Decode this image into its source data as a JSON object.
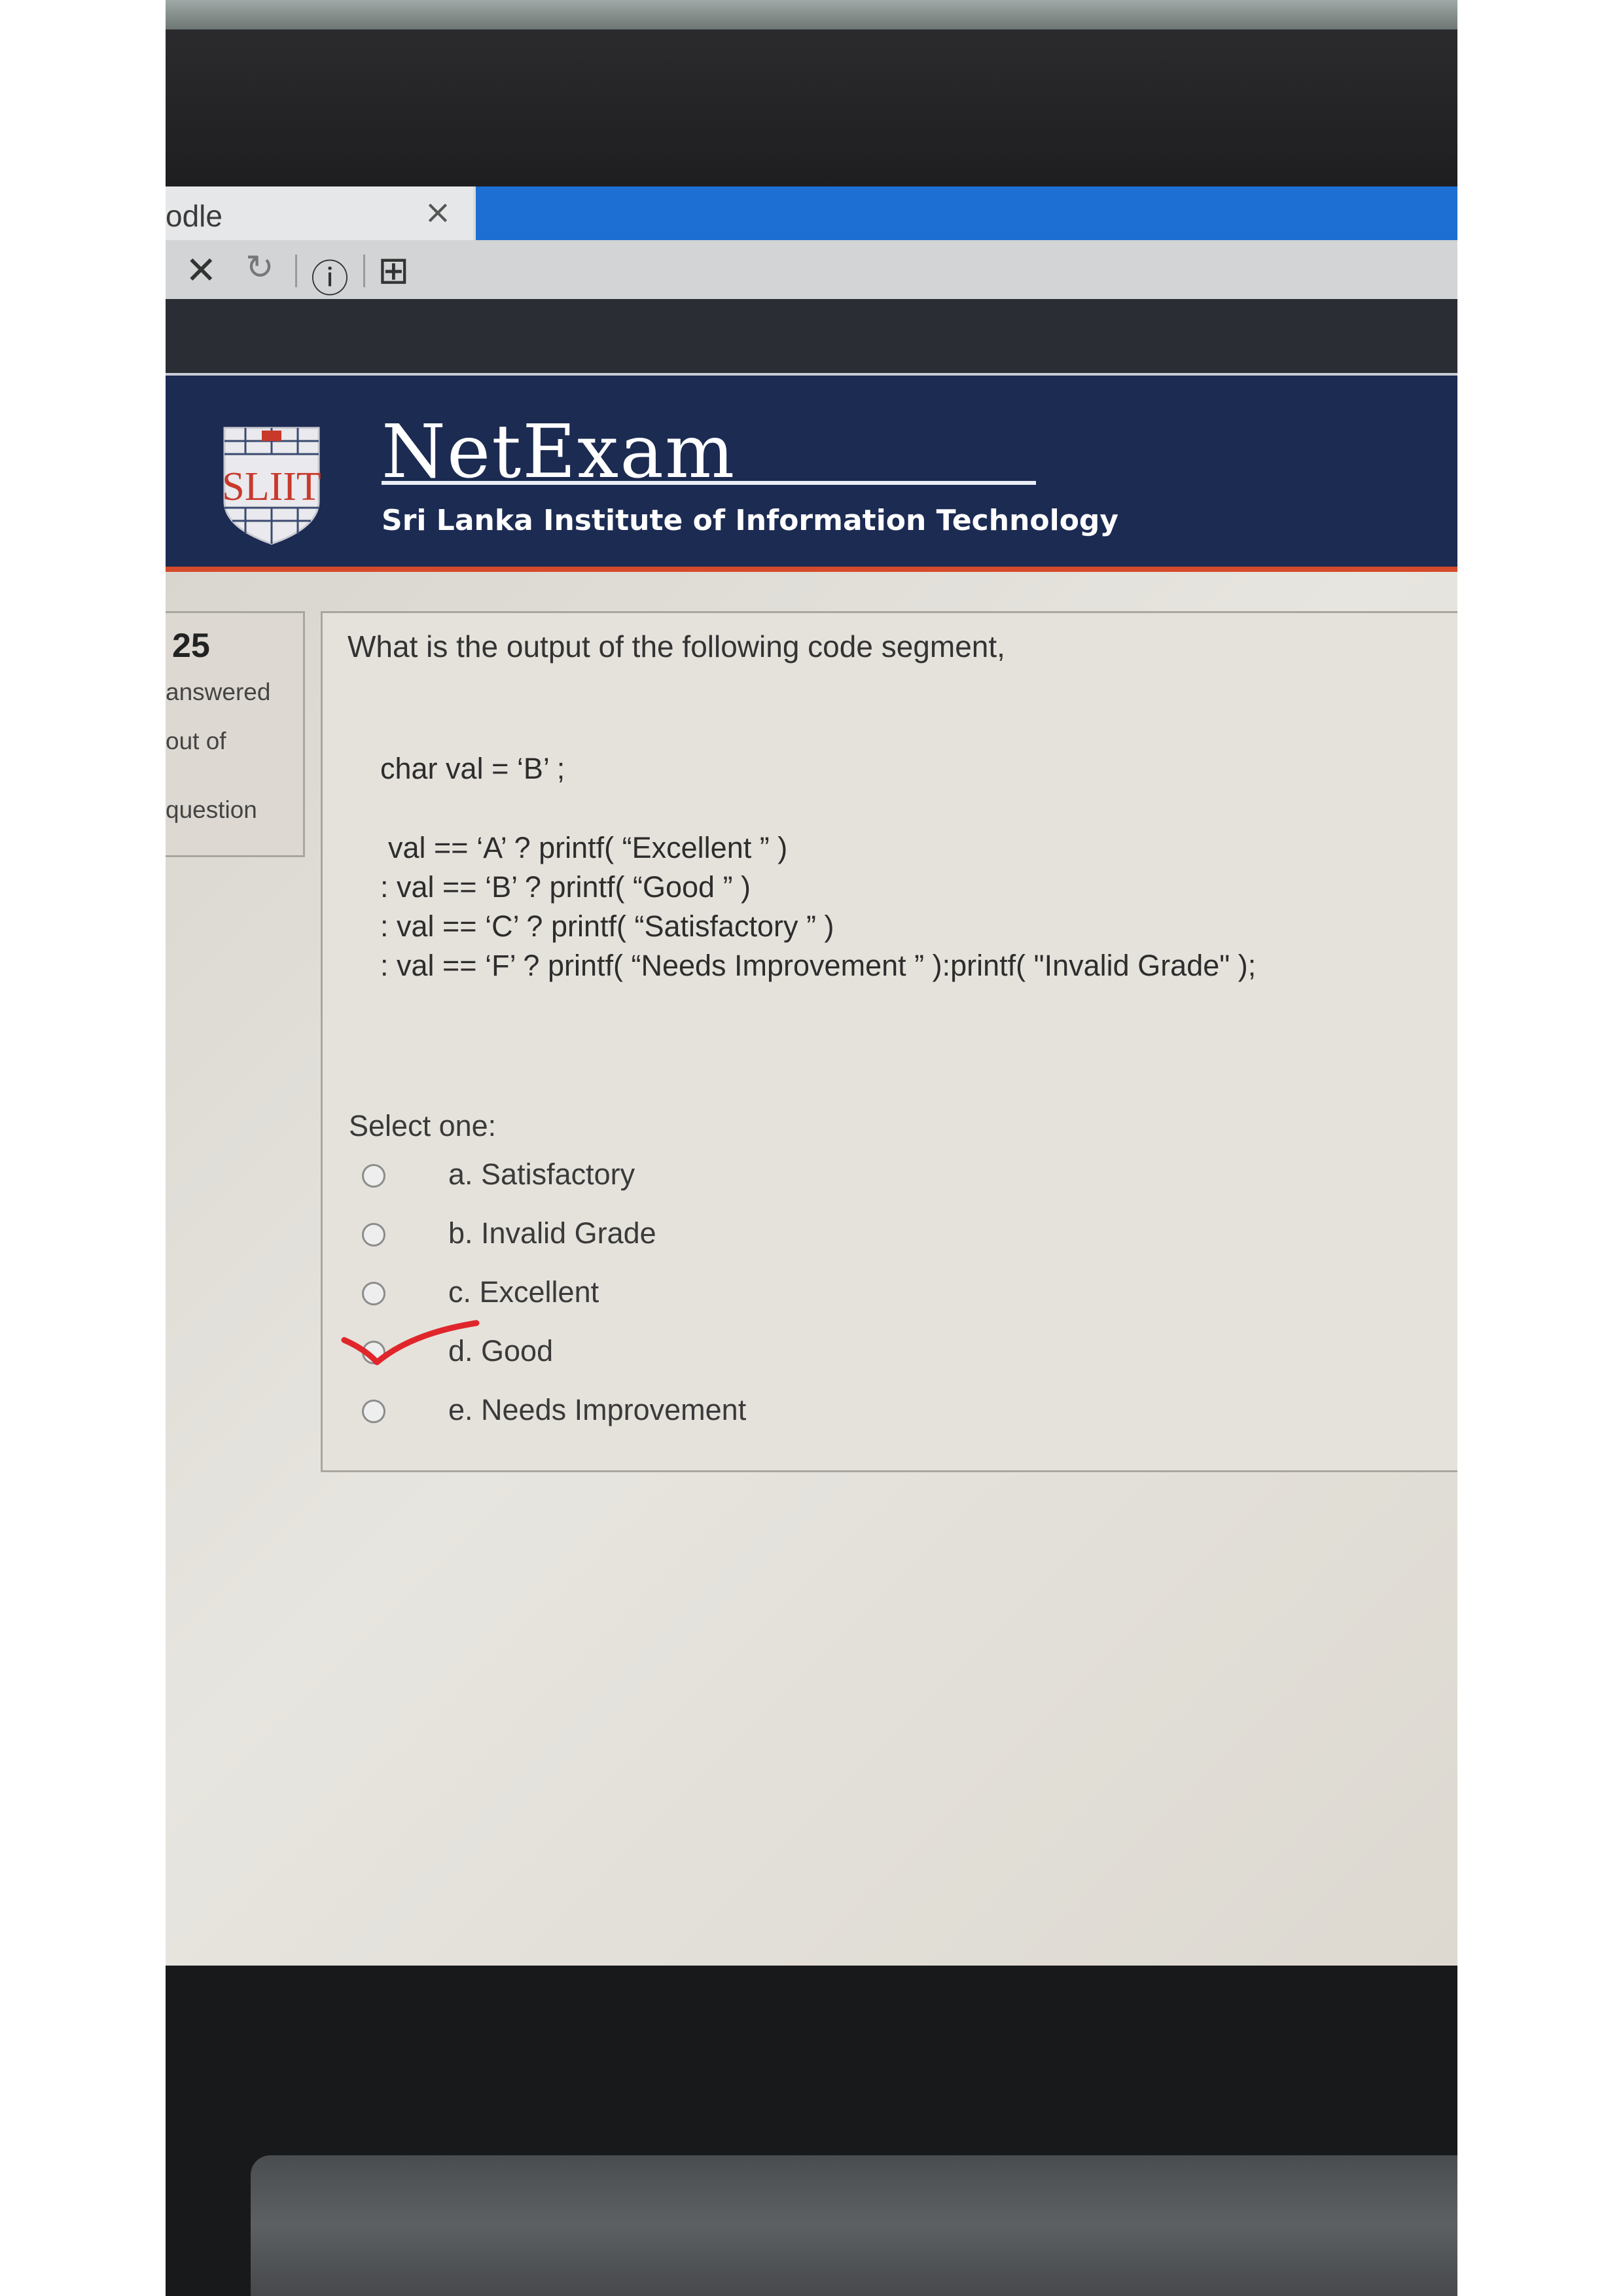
{
  "browser": {
    "tab_title": "odle",
    "tab_close_glyph": "×",
    "toolbar_icons": [
      "close-icon",
      "reload-icon",
      "info-icon",
      "add-page-icon"
    ],
    "stop_glyph": "✕",
    "reload_glyph": "↻",
    "info_glyph": "ⓘ",
    "page_glyph": "⊞",
    "accent_color": "#1d6fd3"
  },
  "header": {
    "logo_text": "SLIIT",
    "brand": "NetExam",
    "subtitle": "Sri Lanka Institute of Information Technology",
    "background_color": "#1c2b52",
    "accent_color": "#d44a2a"
  },
  "sidebar": {
    "question_number": "25",
    "lines": [
      "answered",
      "out of",
      "question"
    ]
  },
  "question": {
    "prompt": "What is the output of the following code segment,",
    "code_lines": [
      "char val = ‘B’ ;",
      "val == ‘A’ ? printf( “Excellent ” )",
      ": val == ‘B’ ? printf( “Good ” )",
      ": val == ‘C’ ? printf( “Satisfactory ” )",
      ": val == ‘F’ ? printf( “Needs Improvement ” ):printf( \"Invalid Grade\" );"
    ],
    "select_label": "Select one:",
    "options": [
      {
        "label": "a. Satisfactory",
        "selected": false
      },
      {
        "label": "b. Invalid Grade",
        "selected": false
      },
      {
        "label": "c. Excellent",
        "selected": false
      },
      {
        "label": "d. Good",
        "selected": false,
        "annotated": true
      },
      {
        "label": "e. Needs Improvement",
        "selected": false
      }
    ],
    "annotation_color": "#e0262b"
  }
}
